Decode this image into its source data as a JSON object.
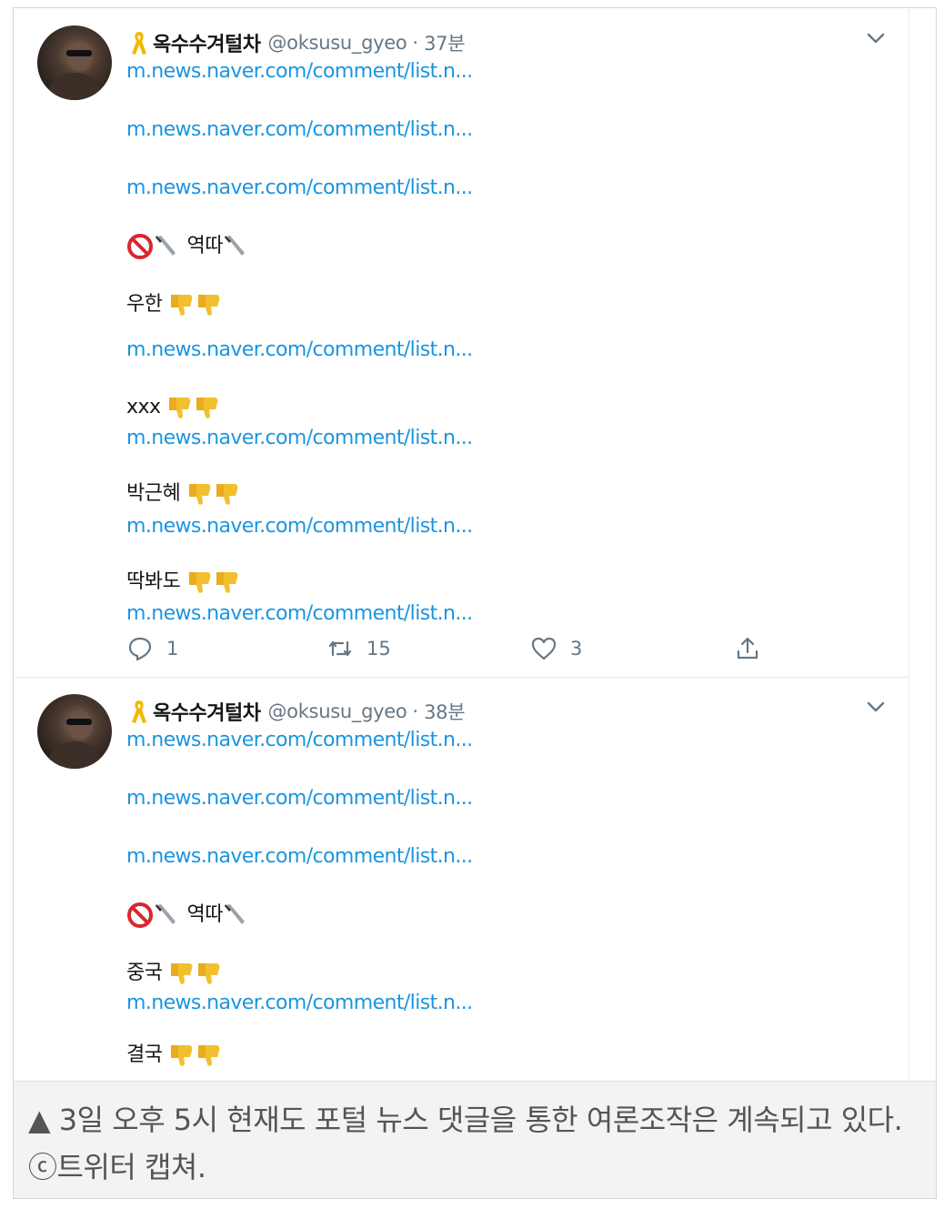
{
  "tweets": [
    {
      "display_name": "옥수수겨털차",
      "handle": "@oksusu_gyeo",
      "separator": "·",
      "time": "37분",
      "lines": [
        {
          "kind": "link",
          "text": "m.news.naver.com/comment/list.n..."
        },
        {
          "kind": "link",
          "text": "m.news.naver.com/comment/list.n..."
        },
        {
          "kind": "link",
          "text": "m.news.naver.com/comment/list.n..."
        },
        {
          "kind": "text",
          "text": "역따",
          "emoji": "no-knife"
        },
        {
          "kind": "text",
          "text": "우한",
          "emoji": "thumbs-down-2"
        },
        {
          "kind": "link",
          "text": "m.news.naver.com/comment/list.n..."
        },
        {
          "kind": "text",
          "text": "xxx",
          "emoji": "thumbs-down-2"
        },
        {
          "kind": "link",
          "text": "m.news.naver.com/comment/list.n..."
        },
        {
          "kind": "text",
          "text": "박근혜",
          "emoji": "thumbs-down-2"
        },
        {
          "kind": "link",
          "text": "m.news.naver.com/comment/list.n..."
        },
        {
          "kind": "text",
          "text": "딱봐도",
          "emoji": "thumbs-down-2"
        },
        {
          "kind": "link",
          "text": "m.news.naver.com/comment/list.n..."
        }
      ],
      "actions": {
        "reply": "1",
        "retweet": "15",
        "like": "3"
      }
    },
    {
      "display_name": "옥수수겨털차",
      "handle": "@oksusu_gyeo",
      "separator": "·",
      "time": "38분",
      "lines": [
        {
          "kind": "link",
          "text": "m.news.naver.com/comment/list.n..."
        },
        {
          "kind": "link",
          "text": "m.news.naver.com/comment/list.n..."
        },
        {
          "kind": "link",
          "text": "m.news.naver.com/comment/list.n..."
        },
        {
          "kind": "text",
          "text": "역따",
          "emoji": "no-knife"
        },
        {
          "kind": "text",
          "text": "중국",
          "emoji": "thumbs-down-2"
        },
        {
          "kind": "link",
          "text": "m.news.naver.com/comment/list.n..."
        },
        {
          "kind": "text",
          "text": "결국",
          "emoji": "thumbs-down-2"
        }
      ]
    }
  ],
  "caption": "▲ 3일 오후 5시 현재도 포털 뉴스 댓글을 통한 여론조작은 계속되고 있다. ⓒ트위터 캡쳐.",
  "colors": {
    "link": "#1b95e0",
    "text": "#14171a",
    "muted": "#657786",
    "ribbon": "#f5b800",
    "thumbs": "#f2c02e",
    "prohibited": "#d9272e"
  }
}
